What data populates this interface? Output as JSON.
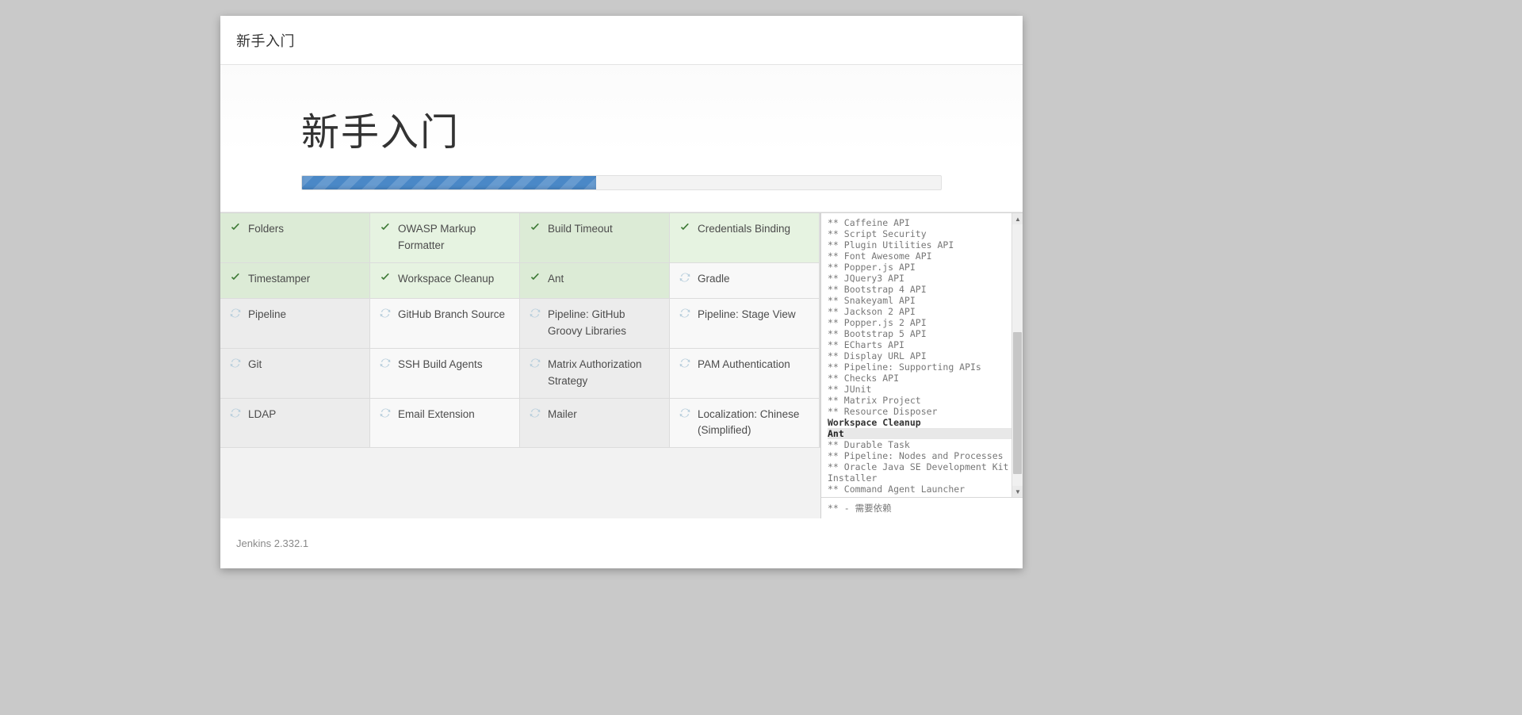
{
  "window": {
    "header_title": "新手入门",
    "hero_title": "新手入门",
    "footer_version": "Jenkins 2.332.1"
  },
  "progress": {
    "percent": 46,
    "fill_color": "#4a88c7",
    "track_color": "#f3f3f3"
  },
  "colors": {
    "done_bg_a": "#dcebd6",
    "done_bg_b": "#e6f3e1",
    "pending_bg_a": "#ececec",
    "pending_bg_b": "#f8f8f8",
    "check_color": "#3e7a36",
    "spinner_color": "#b9cfdd",
    "page_bg": "#c9c9c9"
  },
  "plugins": [
    {
      "name": "Folders",
      "status": "done",
      "icon": "check-icon"
    },
    {
      "name": "OWASP Markup Formatter",
      "status": "done",
      "icon": "check-icon"
    },
    {
      "name": "Build Timeout",
      "status": "done",
      "icon": "check-icon"
    },
    {
      "name": "Credentials Binding",
      "status": "done",
      "icon": "check-icon"
    },
    {
      "name": "Timestamper",
      "status": "done",
      "icon": "check-icon"
    },
    {
      "name": "Workspace Cleanup",
      "status": "done",
      "icon": "check-icon"
    },
    {
      "name": "Ant",
      "status": "done",
      "icon": "check-icon"
    },
    {
      "name": "Gradle",
      "status": "pending",
      "icon": "refresh-icon"
    },
    {
      "name": "Pipeline",
      "status": "pending",
      "icon": "refresh-icon"
    },
    {
      "name": "GitHub Branch Source",
      "status": "pending",
      "icon": "refresh-icon"
    },
    {
      "name": "Pipeline: GitHub Groovy Libraries",
      "status": "pending",
      "icon": "refresh-icon"
    },
    {
      "name": "Pipeline: Stage View",
      "status": "pending",
      "icon": "refresh-icon"
    },
    {
      "name": "Git",
      "status": "pending",
      "icon": "refresh-icon"
    },
    {
      "name": "SSH Build Agents",
      "status": "pending",
      "icon": "refresh-icon"
    },
    {
      "name": "Matrix Authorization Strategy",
      "status": "pending",
      "icon": "refresh-icon"
    },
    {
      "name": "PAM Authentication",
      "status": "pending",
      "icon": "refresh-icon"
    },
    {
      "name": "LDAP",
      "status": "pending",
      "icon": "refresh-icon"
    },
    {
      "name": "Email Extension",
      "status": "pending",
      "icon": "refresh-icon"
    },
    {
      "name": "Mailer",
      "status": "pending",
      "icon": "refresh-icon"
    },
    {
      "name": "Localization: Chinese (Simplified)",
      "status": "pending",
      "icon": "refresh-icon"
    }
  ],
  "log": {
    "lines": [
      {
        "text": "** Caffeine API",
        "type": "dep"
      },
      {
        "text": "** Script Security",
        "type": "dep"
      },
      {
        "text": "** Plugin Utilities API",
        "type": "dep"
      },
      {
        "text": "** Font Awesome API",
        "type": "dep"
      },
      {
        "text": "** Popper.js API",
        "type": "dep"
      },
      {
        "text": "** JQuery3 API",
        "type": "dep"
      },
      {
        "text": "** Bootstrap 4 API",
        "type": "dep"
      },
      {
        "text": "** Snakeyaml API",
        "type": "dep"
      },
      {
        "text": "** Jackson 2 API",
        "type": "dep"
      },
      {
        "text": "** Popper.js 2 API",
        "type": "dep"
      },
      {
        "text": "** Bootstrap 5 API",
        "type": "dep"
      },
      {
        "text": "** ECharts API",
        "type": "dep"
      },
      {
        "text": "** Display URL API",
        "type": "dep"
      },
      {
        "text": "** Pipeline: Supporting APIs",
        "type": "dep"
      },
      {
        "text": "** Checks API",
        "type": "dep"
      },
      {
        "text": "** JUnit",
        "type": "dep"
      },
      {
        "text": "** Matrix Project",
        "type": "dep"
      },
      {
        "text": "** Resource Disposer",
        "type": "dep"
      },
      {
        "text": "Workspace Cleanup",
        "type": "plain"
      },
      {
        "text": "Ant",
        "type": "current"
      },
      {
        "text": "** Durable Task",
        "type": "dep"
      },
      {
        "text": "** Pipeline: Nodes and Processes",
        "type": "dep"
      },
      {
        "text": "** Oracle Java SE Development Kit Installer",
        "type": "dep"
      },
      {
        "text": "** Command Agent Launcher",
        "type": "dep"
      }
    ],
    "legend": "** - 需要依赖",
    "scrollbar": {
      "up_glyph": "▲",
      "down_glyph": "▼"
    }
  }
}
